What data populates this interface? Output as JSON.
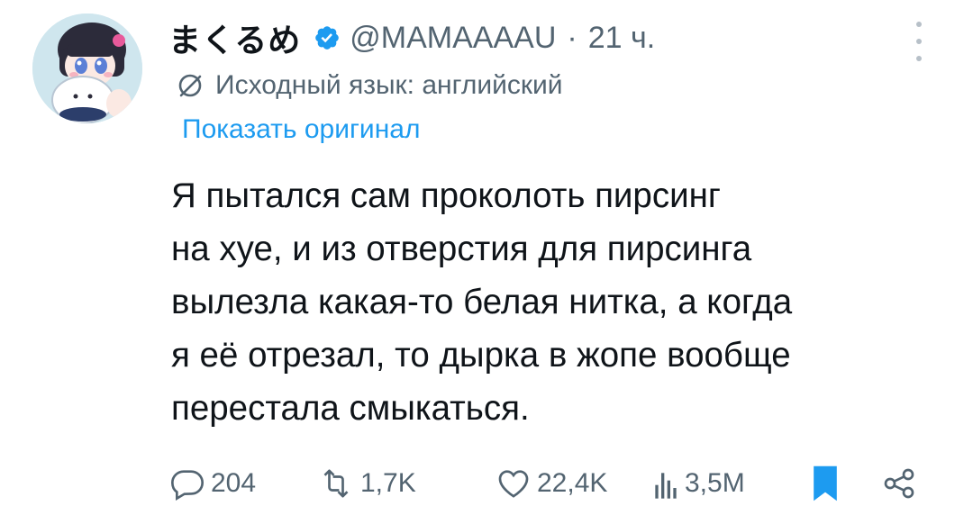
{
  "tweet": {
    "author": {
      "display_name": "まくるめ",
      "handle": "@MAMAAAAU",
      "verified": true,
      "avatar_icon": "avatar-anime-character"
    },
    "separator": "·",
    "time": "21 ч.",
    "translation": {
      "icon": "globe-translate-icon",
      "source_language_text": "Исходный язык: английский",
      "show_original_label": "Показать оригинал"
    },
    "text_lines": [
      "Я пытался сам проколоть пирсинг",
      "на хуе, и из отверстия для пирсинга",
      "вылезла какая-то белая нитка, а когда",
      "я её отрезал, то дырка в жопе вообще",
      "перестала смыкаться."
    ],
    "actions": {
      "replies": "204",
      "retweets": "1,7K",
      "likes": "22,4K",
      "views": "3,5M"
    }
  },
  "colors": {
    "text_primary": "#0f1419",
    "text_secondary": "#536471",
    "accent": "#1d9bf0"
  }
}
